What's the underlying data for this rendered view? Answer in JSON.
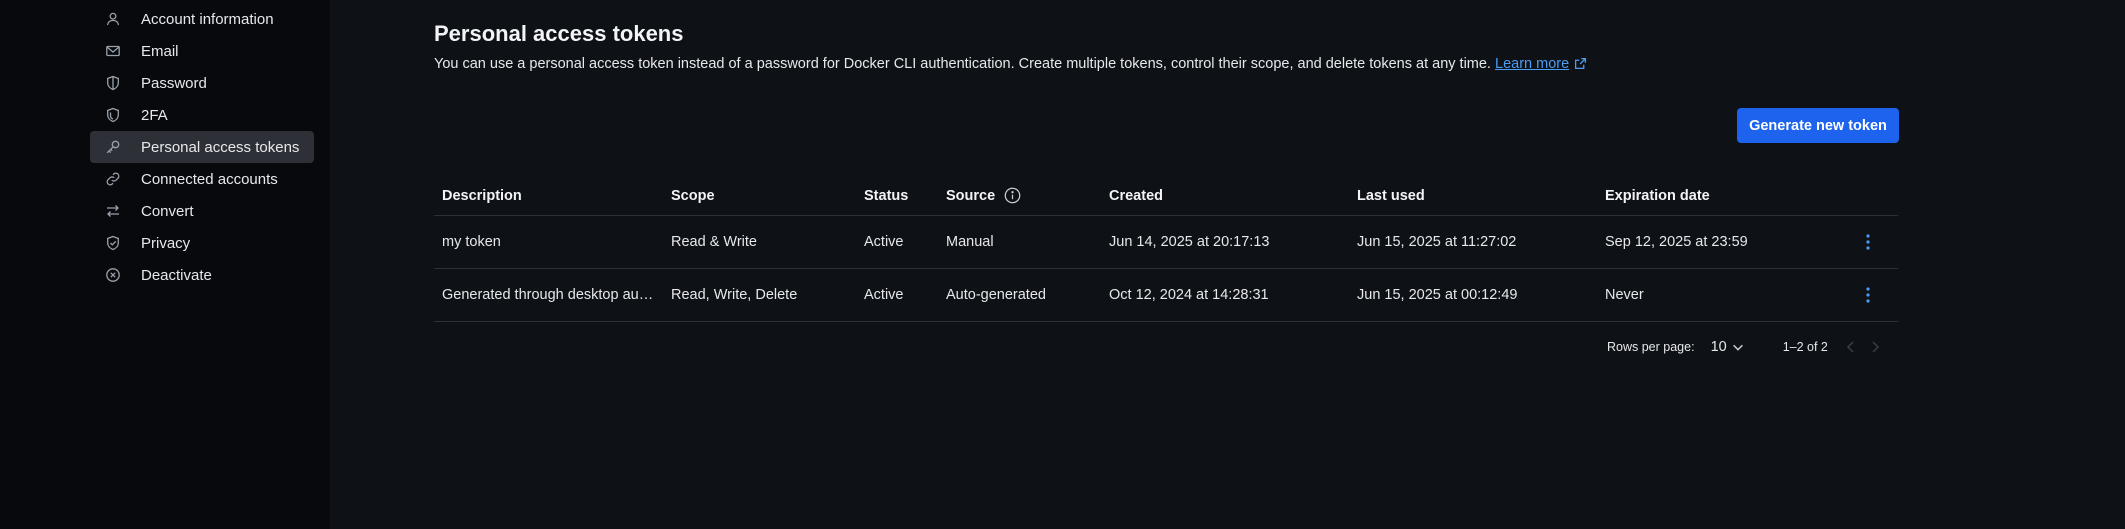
{
  "sidebar": {
    "items": [
      {
        "label": "Account information",
        "icon": "user-icon",
        "active": false
      },
      {
        "label": "Email",
        "icon": "mail-icon",
        "active": false
      },
      {
        "label": "Password",
        "icon": "shield-icon",
        "active": false
      },
      {
        "label": "2FA",
        "icon": "shield-2fa-icon",
        "active": false
      },
      {
        "label": "Personal access tokens",
        "icon": "key-icon",
        "active": true
      },
      {
        "label": "Connected accounts",
        "icon": "link-icon",
        "active": false
      },
      {
        "label": "Convert",
        "icon": "convert-arrows-icon",
        "active": false
      },
      {
        "label": "Privacy",
        "icon": "shield-check-icon",
        "active": false
      },
      {
        "label": "Deactivate",
        "icon": "circle-x-icon",
        "active": false
      }
    ]
  },
  "main": {
    "title": "Personal access tokens",
    "description": "You can use a personal access token instead of a password for Docker CLI authentication. Create multiple tokens, control their scope, and delete tokens at any time.",
    "learn_more": "Learn more",
    "generate_button": "Generate new token"
  },
  "table": {
    "headers": {
      "description": "Description",
      "scope": "Scope",
      "status": "Status",
      "source": "Source",
      "created": "Created",
      "last_used": "Last used",
      "expiration": "Expiration date"
    },
    "rows": [
      {
        "description": "my token",
        "scope": "Read & Write",
        "status": "Active",
        "source": "Manual",
        "created": "Jun 14, 2025 at 20:17:13",
        "last_used": "Jun 15, 2025 at 11:27:02",
        "expiration": "Sep 12, 2025 at 23:59"
      },
      {
        "description": "Generated through desktop auth…",
        "scope": "Read, Write, Delete",
        "status": "Active",
        "source": "Auto-generated",
        "created": "Oct 12, 2024 at 14:28:31",
        "last_used": "Jun 15, 2025 at 00:12:49",
        "expiration": "Never"
      }
    ]
  },
  "pagination": {
    "rows_per_page_label": "Rows per page:",
    "rows_per_page_value": "10",
    "range": "1–2 of 2"
  },
  "colors": {
    "accent": "#1d63ed",
    "link": "#4b9cf5",
    "kebab": "#4b9cf5",
    "sidebar_bg": "#07090c",
    "main_bg": "#0e1116",
    "active_item_bg": "#2d3036"
  }
}
